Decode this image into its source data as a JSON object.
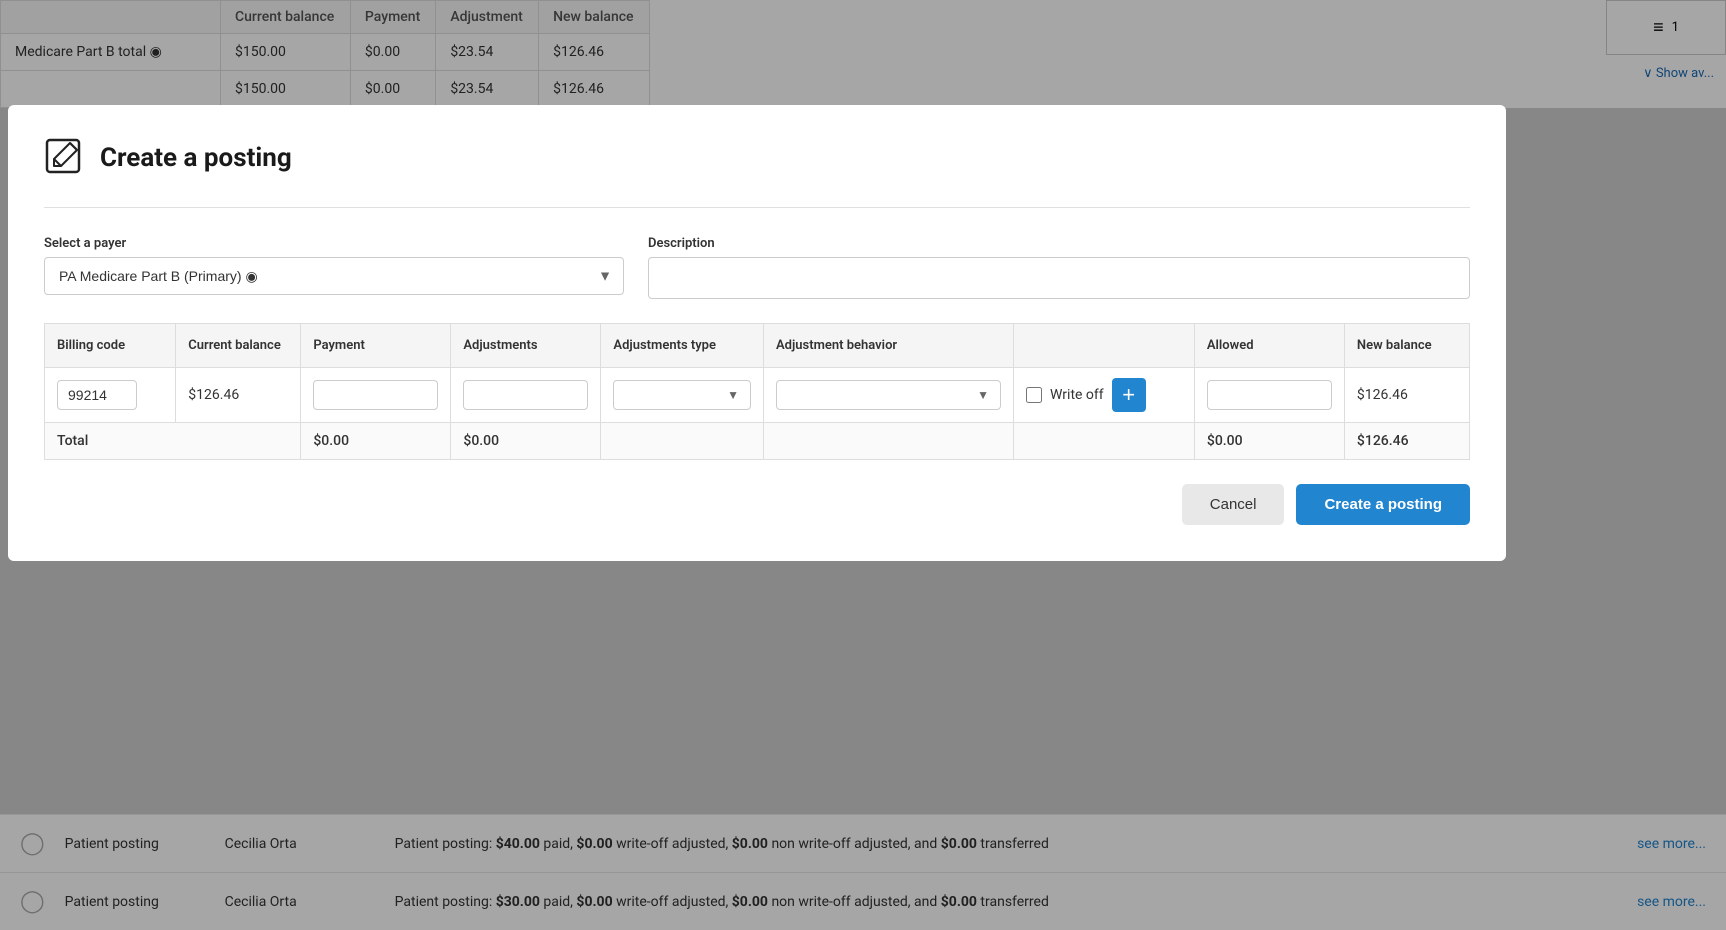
{
  "modal": {
    "title": "Create a posting",
    "divider": true
  },
  "form": {
    "payer_label": "Select a payer",
    "payer_value": "PA Medicare Part B (Primary) ◉",
    "description_label": "Description",
    "description_placeholder": ""
  },
  "table": {
    "headers": {
      "billing_code": "Billing code",
      "current_balance": "Current balance",
      "payment": "Payment",
      "adjustments": "Adjustments",
      "adjustments_type": "Adjustments type",
      "adjustment_behavior": "Adjustment behavior",
      "allowed": "Allowed",
      "new_balance": "New balance"
    },
    "rows": [
      {
        "billing_code": "99214",
        "current_balance": "$126.46",
        "payment": "",
        "adjustments": "",
        "adjustments_type": "",
        "adjustment_behavior": "",
        "allowed": "",
        "new_balance": "$126.46"
      }
    ],
    "total": {
      "label": "Total",
      "payment": "$0.00",
      "adjustments": "$0.00",
      "allowed": "$0.00",
      "new_balance": "$126.46"
    }
  },
  "buttons": {
    "cancel": "Cancel",
    "create": "Create a posting",
    "add": "+"
  },
  "write_off_label": "Write off",
  "bg_table": {
    "headers": [
      "",
      "Current balance",
      "Payment",
      "Adjustment",
      "New balance"
    ],
    "rows": [
      {
        "label": "Medicare Part B total ◉",
        "col1": "$150.00",
        "col2": "$0.00",
        "col3": "$23.54",
        "col4": "$126.46"
      },
      {
        "label": "",
        "col1": "$150.00",
        "col2": "$0.00",
        "col3": "$23.54",
        "col4": "$126.46"
      }
    ]
  },
  "bottom_rows": [
    {
      "type": "Patient posting",
      "name": "Cecilia Orta",
      "desc_prefix": "Patient posting: ",
      "paid": "$40.00",
      "writeoff": "$0.00",
      "non_writeoff": "$0.00",
      "transferred": "$0.00",
      "see_more": "see more..."
    },
    {
      "type": "Patient posting",
      "name": "Cecilia Orta",
      "desc_prefix": "Patient posting: ",
      "paid": "$30.00",
      "writeoff": "$0.00",
      "non_writeoff": "$0.00",
      "transferred": "$0.00",
      "see_more": "see more..."
    }
  ],
  "pagination": {
    "icon": "≡",
    "page": "1"
  },
  "show_available": "∨ Show av..."
}
